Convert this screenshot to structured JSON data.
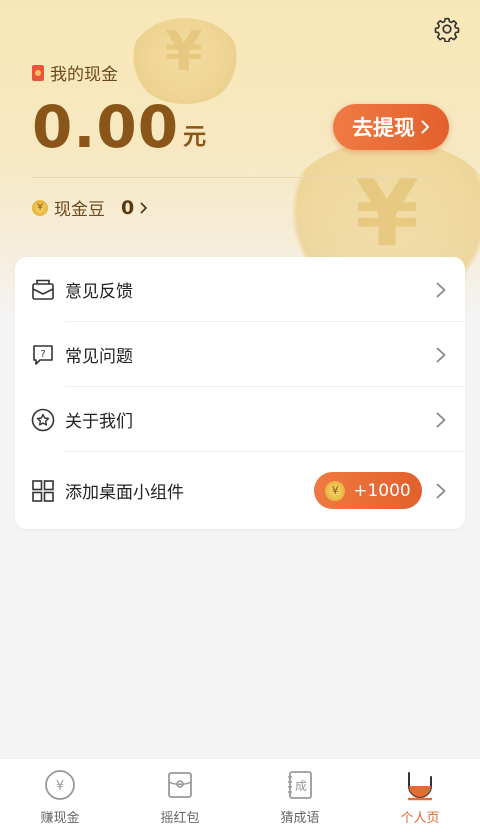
{
  "cash": {
    "title": "我的现金",
    "amount": "0.00",
    "unit": "元",
    "withdraw_label": "去提现",
    "beans_label": "现金豆",
    "beans_value": "0"
  },
  "menu": {
    "items": [
      {
        "label": "意见反馈",
        "icon": "mail-icon"
      },
      {
        "label": "常见问题",
        "icon": "question-icon"
      },
      {
        "label": "关于我们",
        "icon": "star-icon"
      },
      {
        "label": "添加桌面小组件",
        "icon": "grid-icon",
        "badge": "+1000"
      }
    ]
  },
  "tabbar": {
    "tabs": [
      {
        "label": "赚现金",
        "icon": "yen-coin-icon"
      },
      {
        "label": "摇红包",
        "icon": "red-packet-icon"
      },
      {
        "label": "猜成语",
        "icon": "idiom-book-icon"
      },
      {
        "label": "个人页",
        "icon": "profile-icon",
        "active": true
      }
    ]
  },
  "colors": {
    "accent": "#e56a33",
    "gold_text": "#8a5518",
    "hero_bg": "#f8e7b6"
  }
}
